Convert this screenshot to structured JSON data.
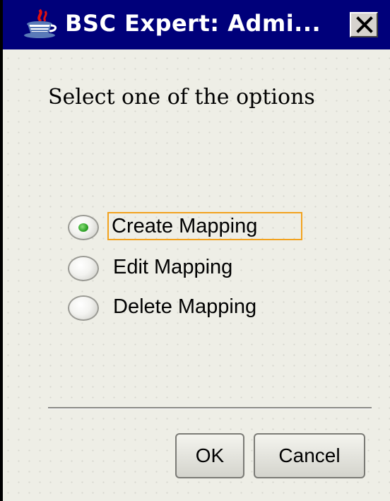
{
  "window": {
    "title": "BSC Expert: Admi...",
    "icon": "java-coffee-cup-icon",
    "close_icon": "close-x-icon"
  },
  "prompt": "Select one of the options",
  "options": [
    {
      "label": "Create Mapping",
      "selected": true
    },
    {
      "label": "Edit Mapping",
      "selected": false
    },
    {
      "label": "Delete Mapping",
      "selected": false
    }
  ],
  "buttons": {
    "ok_label": "OK",
    "cancel_label": "Cancel"
  },
  "colors": {
    "titlebar": "#00007a",
    "background": "#eeeee6",
    "focus_outline": "#f2a21e",
    "radio_selected": "#2fa328"
  }
}
